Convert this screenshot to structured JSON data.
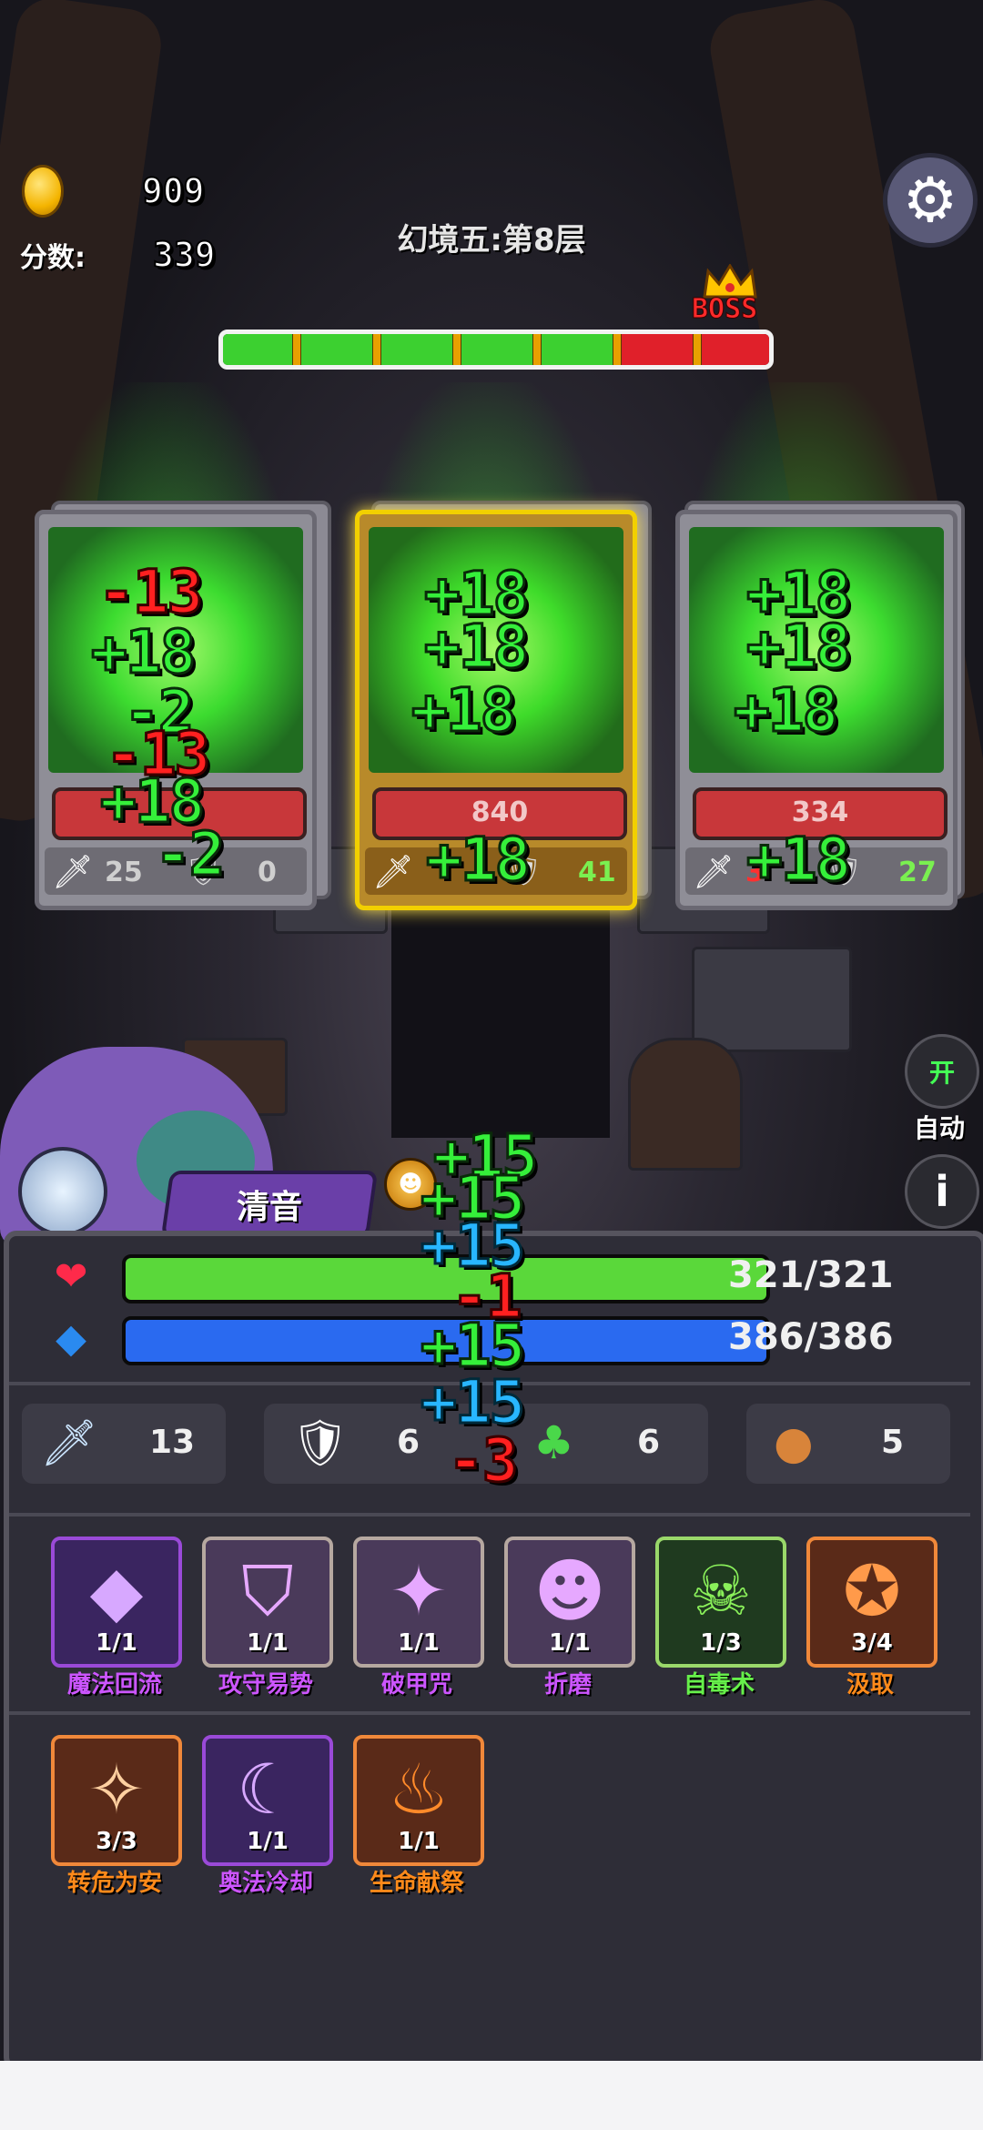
{
  "hud": {
    "gold": "909",
    "score_label": "分数:",
    "score": "339",
    "level_title": "幻境五:第8层",
    "boss_label": "BOSS",
    "progress_fraction": 0.72
  },
  "cards": [
    {
      "hp": "",
      "atk": "25",
      "def": "0",
      "selected": false
    },
    {
      "hp": "840",
      "atk": "",
      "def": "41",
      "selected": true
    },
    {
      "hp": "334",
      "atk": "3",
      "def": "27",
      "selected": false
    }
  ],
  "floats": {
    "card1": [
      "-13",
      "+18",
      "-2",
      "-13",
      "+18",
      "-2"
    ],
    "card2": [
      "+18",
      "+18",
      "+18",
      "+18"
    ],
    "card3": [
      "+18",
      "+18",
      "+18",
      "+18"
    ],
    "player": [
      "+15",
      "+15",
      "+15",
      "-1",
      "+15",
      "+15",
      "-3"
    ]
  },
  "player": {
    "name": "清音",
    "hp": "321/321",
    "mp": "386/386",
    "hp_fraction": 1.0,
    "mp_fraction": 1.0,
    "attack": "13",
    "defense": "6",
    "luck": "6",
    "bag": "5"
  },
  "controls": {
    "auto_state": "开",
    "auto_label": "自动",
    "info_symbol": "i"
  },
  "skills": [
    {
      "name": "魔法回流",
      "count": "1/1",
      "icon": "crystal-icon",
      "color": "purple"
    },
    {
      "name": "攻守易势",
      "count": "1/1",
      "icon": "shield-swap-icon",
      "color": "purple"
    },
    {
      "name": "破甲咒",
      "count": "1/1",
      "icon": "armor-break-icon",
      "color": "purple"
    },
    {
      "name": "折磨",
      "count": "1/1",
      "icon": "torment-icon",
      "color": "purple"
    },
    {
      "name": "自毒术",
      "count": "1/3",
      "icon": "poison-skull-icon",
      "color": "green"
    },
    {
      "name": "汲取",
      "count": "3/4",
      "icon": "drain-icon",
      "color": "orange"
    },
    {
      "name": "转危为安",
      "count": "3/3",
      "icon": "sparkle-slash-icon",
      "color": "orange"
    },
    {
      "name": "奥法冷却",
      "count": "1/1",
      "icon": "arcane-moon-icon",
      "color": "purple"
    },
    {
      "name": "生命献祭",
      "count": "1/1",
      "icon": "fire-sacrifice-icon",
      "color": "orange"
    }
  ],
  "colors": {
    "hp_bar": "#5ad83a",
    "mp_bar": "#2a6af0",
    "float_green": "#35f03a",
    "float_red": "#ff2020",
    "float_blue": "#28b6ff"
  }
}
